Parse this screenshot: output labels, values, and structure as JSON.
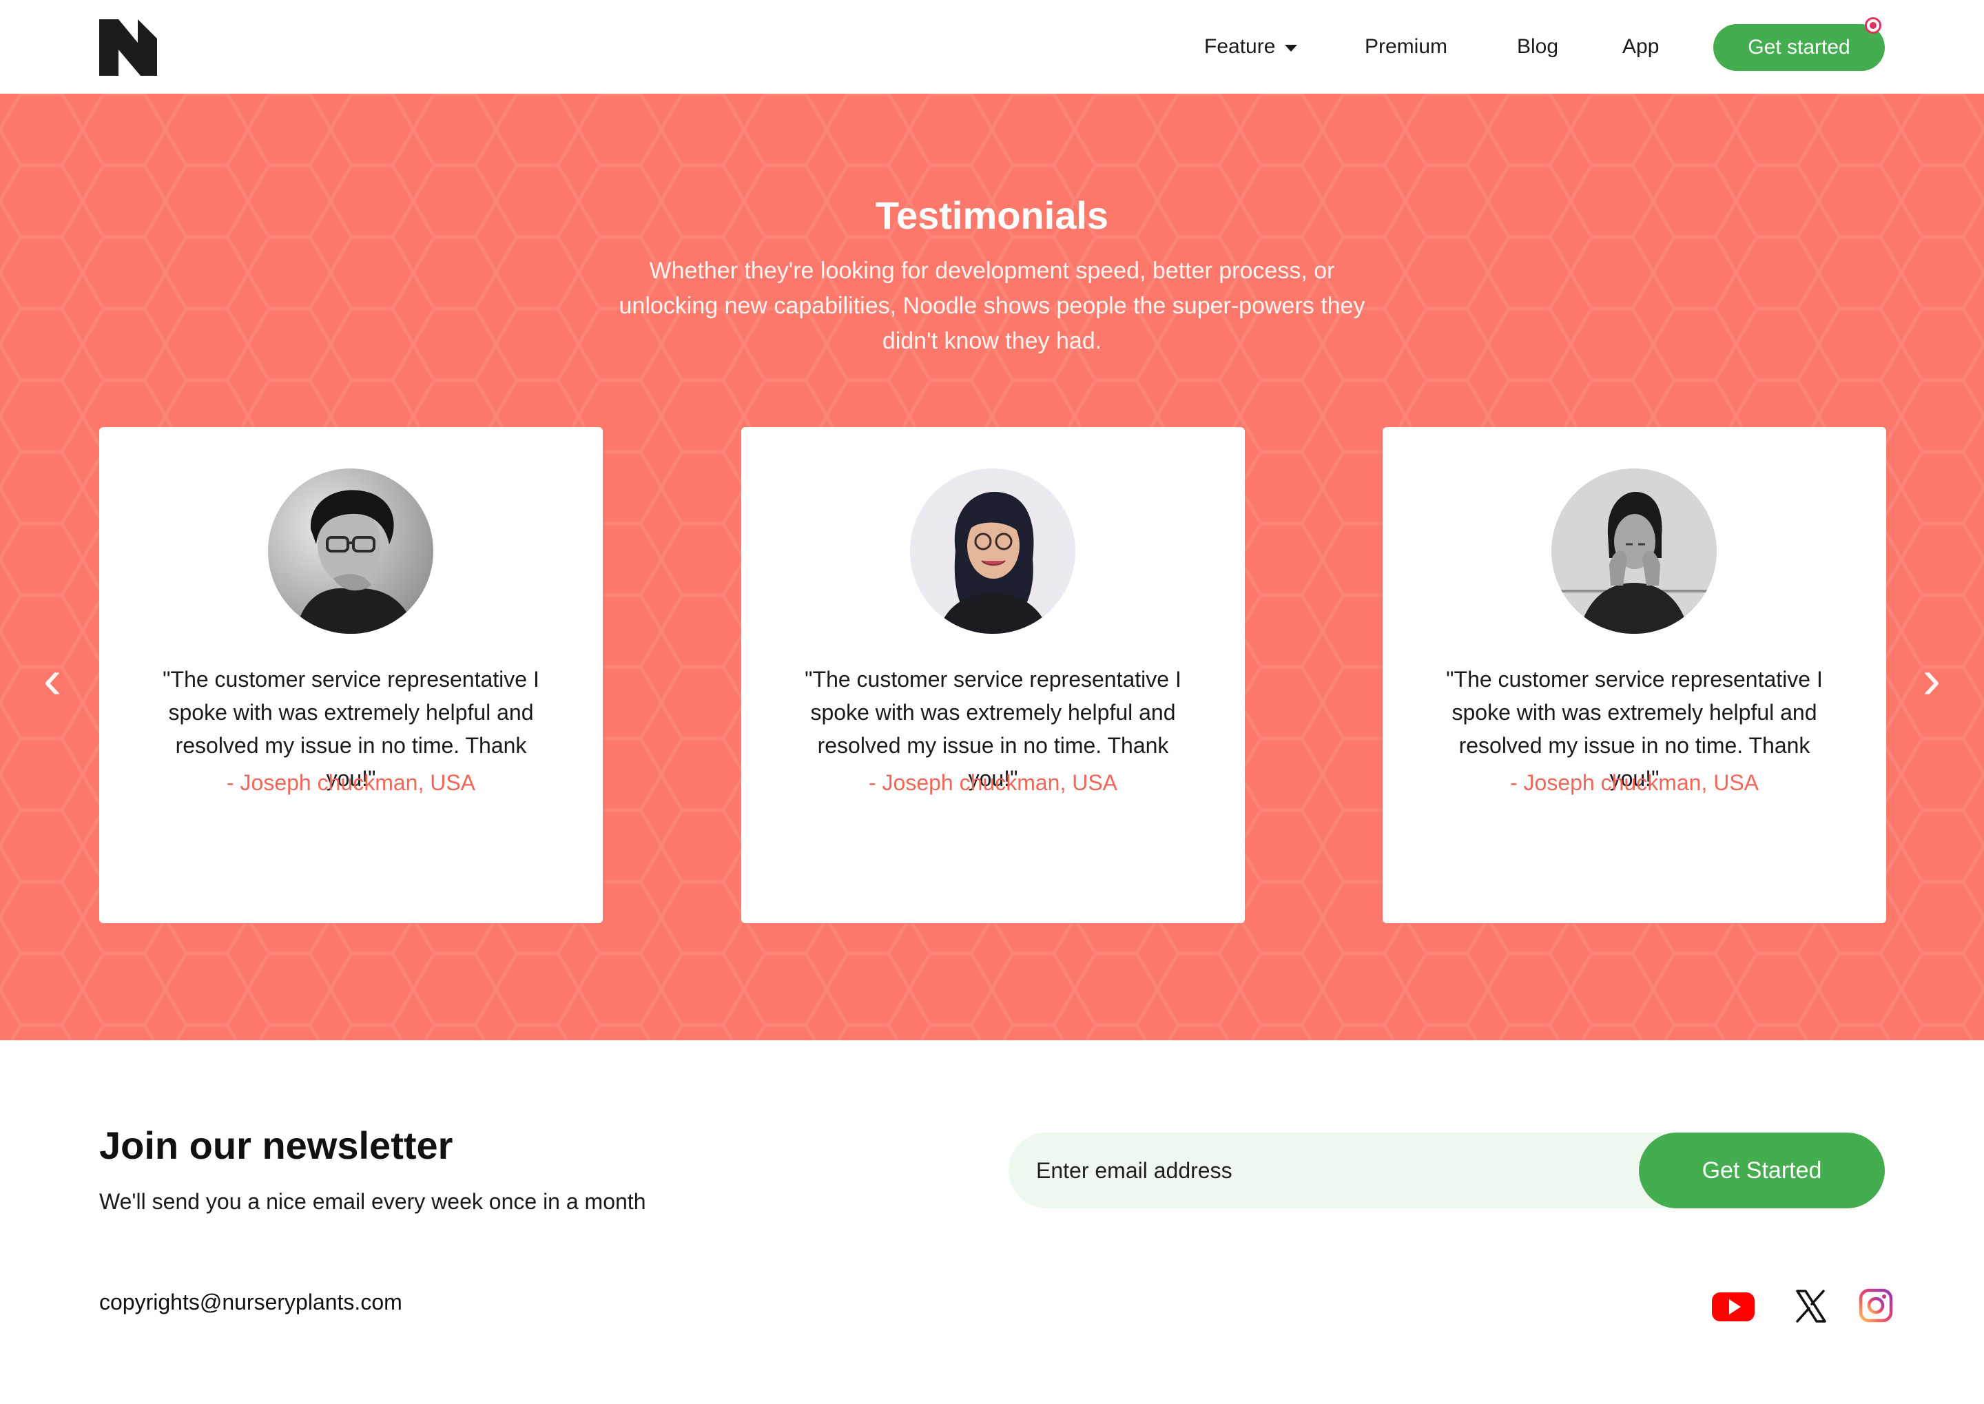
{
  "header": {
    "logo_text": "N",
    "nav": {
      "feature": "Feature",
      "premium": "Premium",
      "blog": "Blog",
      "app": "App"
    },
    "cta": "Get started"
  },
  "testimonials": {
    "title": "Testimonials",
    "subtitle": "Whether they're looking for development speed, better process, or unlocking new capabilities, Noodle shows people the super-powers they didn't know they had.",
    "cards": [
      {
        "quote": "\"The customer service representative I spoke with was extremely helpful and resolved my issue in no time. Thank you!\"",
        "author": "- Joseph chuckman, USA"
      },
      {
        "quote": "\"The customer service representative I spoke with was extremely helpful and resolved my issue in no time. Thank you!\"",
        "author": "- Joseph chuckman, USA"
      },
      {
        "quote": "\"The customer service representative I spoke with was extremely helpful and resolved my issue in no time. Thank you!\"",
        "author": "- Joseph chuckman, USA"
      }
    ],
    "prev_arrow": "‹",
    "next_arrow": "›"
  },
  "newsletter": {
    "title": "Join our newsletter",
    "subtitle": "We'll send you a nice email every week once in a month",
    "placeholder": "Enter email address",
    "button": "Get Started"
  },
  "footer": {
    "copyright": "copyrights@nurseryplants.com",
    "social": [
      "youtube-icon",
      "x-icon",
      "instagram-icon"
    ]
  },
  "colors": {
    "accent_green": "#43ad4f",
    "band_coral": "#fc786b",
    "author_coral": "#f0675a",
    "input_bg": "#eef8ee"
  }
}
